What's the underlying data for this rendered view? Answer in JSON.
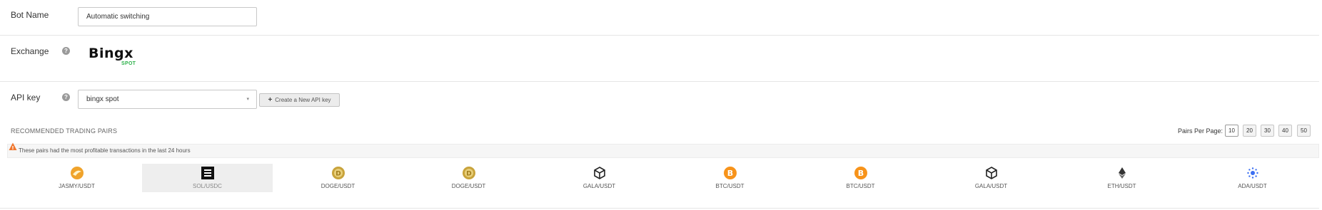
{
  "bot_name": {
    "label": "Bot Name",
    "value": "Automatic switching"
  },
  "exchange": {
    "label": "Exchange",
    "logo_text": "Bingx",
    "logo_sub": "SPOT"
  },
  "api_key": {
    "label": "API key",
    "selected": "bingx spot",
    "create_button": "Create a New API key"
  },
  "recommended": {
    "title": "RECOMMENDED TRADING PAIRS",
    "notice": "These pairs had the most profitable transactions in the last 24 hours",
    "pairs_per_page_label": "Pairs Per Page:",
    "pairs_per_page_options": [
      "10",
      "20",
      "30",
      "40",
      "50"
    ],
    "pairs_per_page_selected": "10",
    "pairs": [
      {
        "name": "JASMY/USDT",
        "icon": "jasmy-coin-icon",
        "color": "#f0a32b"
      },
      {
        "name": "SOL/USDC",
        "icon": "sol-coin-icon",
        "color": "#111111",
        "selected": true
      },
      {
        "name": "DOGE/USDT",
        "icon": "doge-coin-icon",
        "color": "#c8a33b"
      },
      {
        "name": "DOGE/USDT",
        "icon": "doge-coin-icon",
        "color": "#c8a33b"
      },
      {
        "name": "GALA/USDT",
        "icon": "gala-coin-icon",
        "color": "#222222"
      },
      {
        "name": "BTC/USDT",
        "icon": "btc-coin-icon",
        "color": "#f7931a"
      },
      {
        "name": "BTC/USDT",
        "icon": "btc-coin-icon",
        "color": "#f7931a"
      },
      {
        "name": "GALA/USDT",
        "icon": "gala-coin-icon",
        "color": "#222222"
      },
      {
        "name": "ETH/USDT",
        "icon": "eth-coin-icon",
        "color": "#343434"
      },
      {
        "name": "ADA/USDT",
        "icon": "ada-coin-icon",
        "color": "#3c6ff2"
      }
    ]
  },
  "colors": {
    "accent_green": "#2db14a",
    "warning_orange": "#f0762e",
    "selected_bg": "#eeeeee"
  }
}
